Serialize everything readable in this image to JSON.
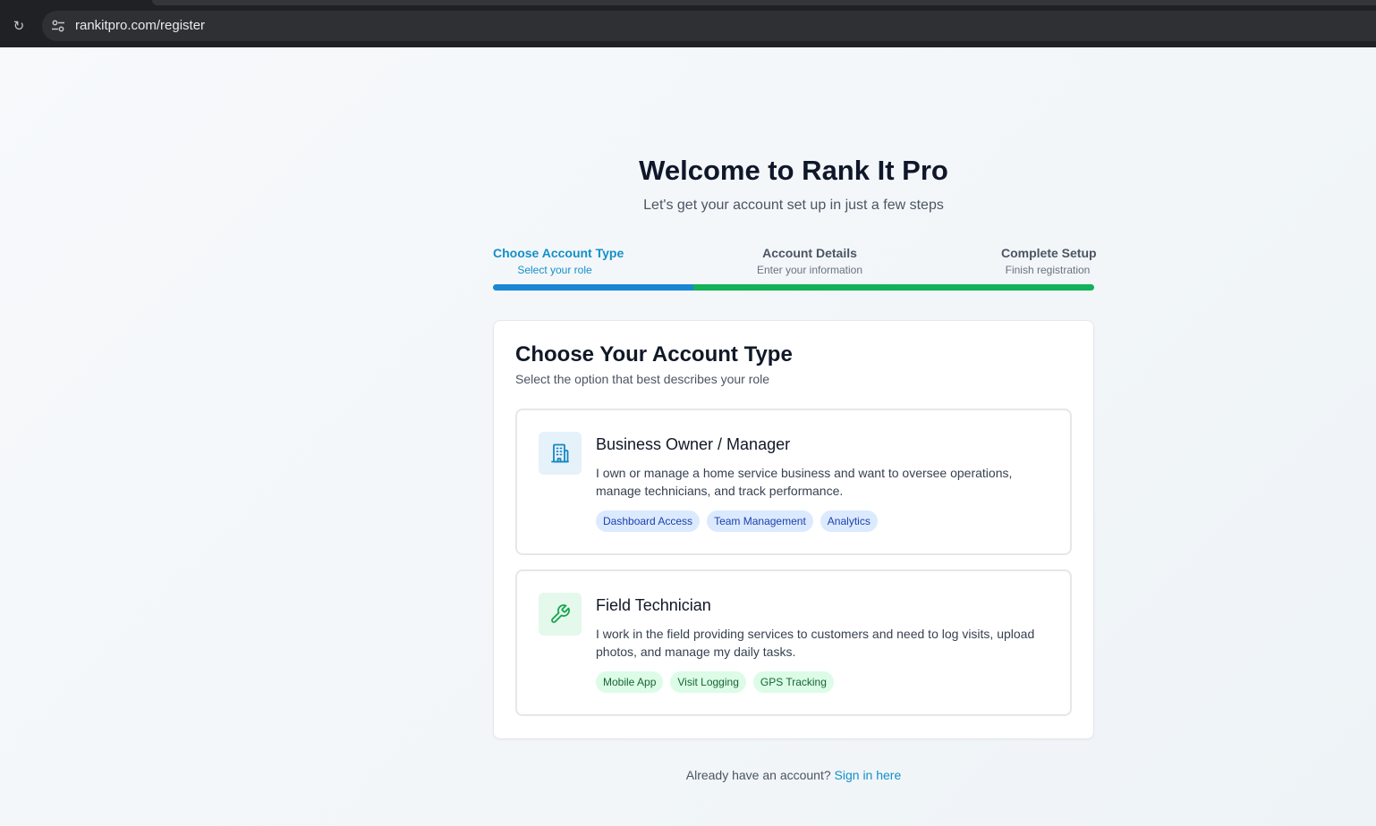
{
  "browser": {
    "url": "rankitpro.com/register"
  },
  "header": {
    "title": "Welcome to Rank It Pro",
    "subtitle": "Let's get your account set up in just a few steps"
  },
  "stepper": {
    "progress_fraction": 0.333,
    "steps": [
      {
        "title": "Choose Account Type",
        "subtitle": "Select your role",
        "state": "active"
      },
      {
        "title": "Account Details",
        "subtitle": "Enter your information",
        "state": "upcoming"
      },
      {
        "title": "Complete Setup",
        "subtitle": "Finish registration",
        "state": "upcoming"
      }
    ]
  },
  "card": {
    "title": "Choose Your Account Type",
    "subtitle": "Select the option that best describes your role",
    "options": [
      {
        "icon": "building-icon",
        "title": "Business Owner / Manager",
        "description": "I own or manage a home service business and want to oversee operations, manage technicians, and track performance.",
        "tags": [
          "Dashboard Access",
          "Team Management",
          "Analytics"
        ]
      },
      {
        "icon": "wrench-icon",
        "title": "Field Technician",
        "description": "I work in the field providing services to customers and need to log visits, upload photos, and manage my daily tasks.",
        "tags": [
          "Mobile App",
          "Visit Logging",
          "GPS Tracking"
        ]
      }
    ]
  },
  "footer": {
    "prompt": "Already have an account?",
    "link": "Sign in here"
  },
  "colors": {
    "accent_blue": "#1390c8",
    "progress_blue": "#1b86d4",
    "progress_green": "#12b15a",
    "owner_icon_bg": "#e6f2fa",
    "tech_icon_bg": "#e4f8ec"
  }
}
